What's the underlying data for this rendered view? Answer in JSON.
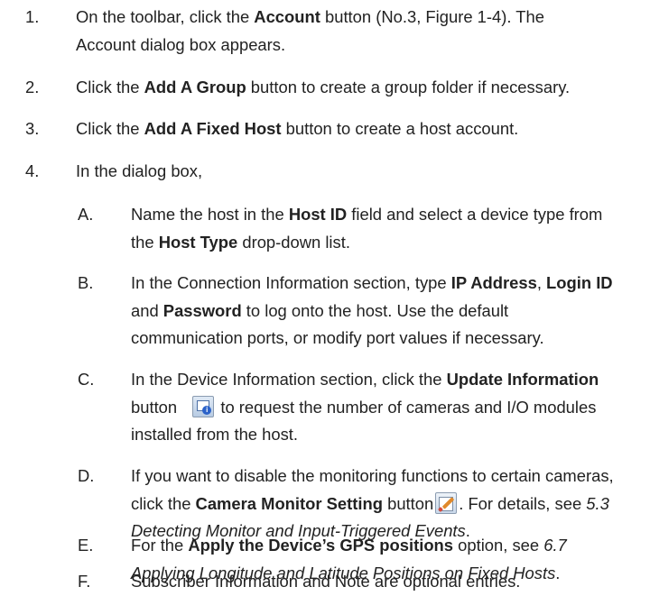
{
  "steps": [
    {
      "num": "1.",
      "line1_a": "On the toolbar, click the ",
      "line1_b": "Account",
      "line1_c": " button (No.3, Figure 1-4). The",
      "line2": "Account dialog box appears."
    },
    {
      "num": "2.",
      "a": "Click the ",
      "b": "Add A Group",
      "c": " button to create a group folder if necessary."
    },
    {
      "num": "3.",
      "a": "Click the ",
      "b": "Add A Fixed Host",
      "c": " button to create a host account."
    },
    {
      "num": "4.",
      "a": "In the dialog box,"
    }
  ],
  "substeps": {
    "A": {
      "num": "A.",
      "l1_a": "Name the host in the ",
      "l1_b": "Host ID",
      "l1_c": " field and select a device type from",
      "l2_a": "the ",
      "l2_b": "Host Type",
      "l2_c": " drop-down list."
    },
    "B": {
      "num": "B.",
      "l1_a": "In the Connection Information section, type ",
      "l1_b": "IP Address",
      "l1_c": ", ",
      "l1_d": "Login ID",
      "l2_a": "and ",
      "l2_b": "Password",
      "l2_c": " to log onto the host. Use the default",
      "l3": "communication ports, or modify port values if necessary."
    },
    "C": {
      "num": "C.",
      "l1_a": "In the Device Information section, click the ",
      "l1_b": "Update Information",
      "l2_a": "button ",
      "l2_c": " to request the number of cameras and I/O modules",
      "l3": "installed from the host."
    },
    "D": {
      "num": "D.",
      "l1": "If you want to disable the monitoring functions to certain cameras,",
      "l2_a": "click the ",
      "l2_b": "Camera Monitor Setting",
      "l2_c": " button",
      "l2_d": ". For details, see ",
      "l2_e": "5.3",
      "l3_a": "Detecting Monitor and Input-Triggered Events",
      "l3_b": "."
    },
    "E": {
      "num": "E.",
      "l1_a": "For the ",
      "l1_b": "Apply the Device’s GPS positions",
      "l1_c": " option, see ",
      "l1_d": "6.7",
      "l2_a": "Applying Longitude and Latitude Positions on Fixed Hosts",
      "l2_b": "."
    },
    "F": {
      "num": "F.",
      "l1": "Subscriber Information and Note are optional entries."
    }
  },
  "icons": {
    "update_information": "update-information-icon",
    "camera_monitor_setting": "camera-monitor-setting-icon"
  }
}
